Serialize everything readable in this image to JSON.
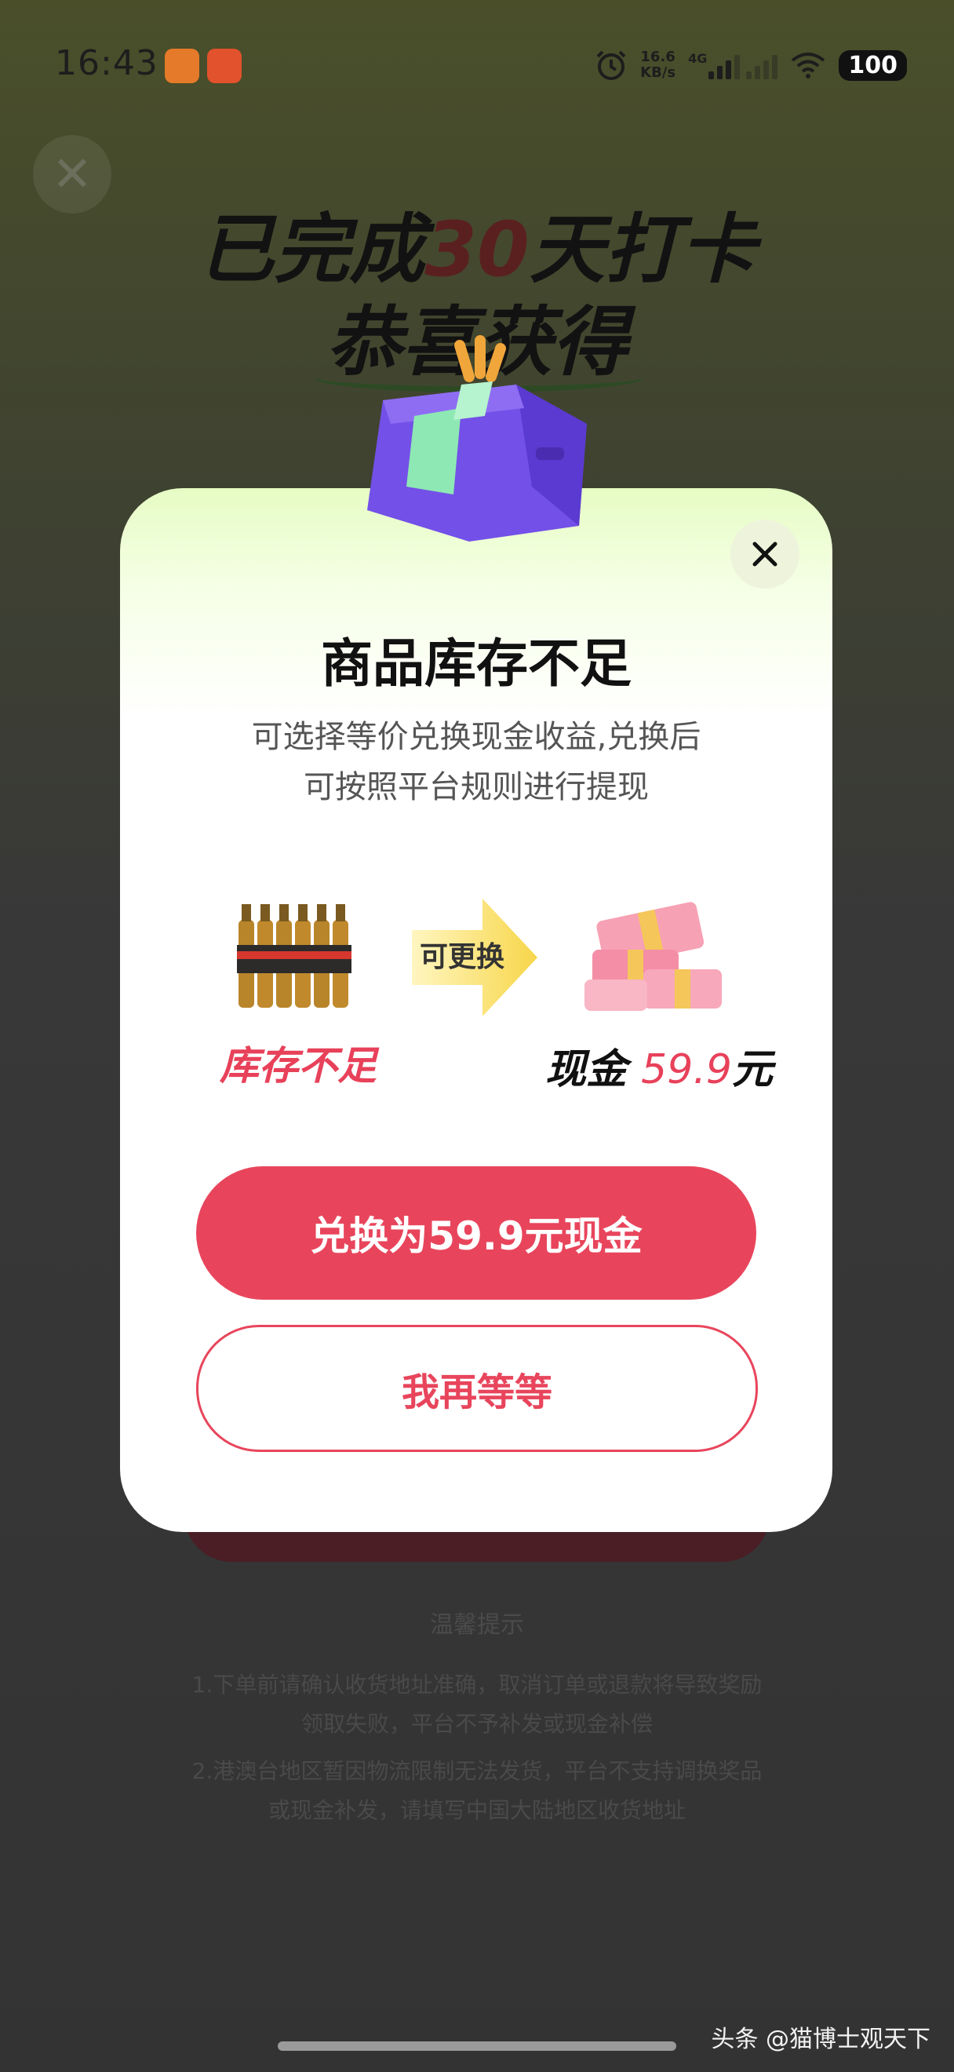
{
  "status_bar": {
    "time": "16:43",
    "net_speed_value": "16.6",
    "net_speed_unit": "KB/s",
    "network": "4G",
    "battery": "100",
    "icons": [
      "app-icon-orange",
      "app-icon-red",
      "alarm-icon",
      "signal-icon",
      "wifi-icon"
    ]
  },
  "background": {
    "title_prefix": "已完成",
    "title_days": "30",
    "title_suffix": "天打卡",
    "subtitle": "恭喜获得",
    "tips_title": "温馨提示",
    "tips": [
      "1.下单前请确认收货地址准确，取消订单或退款将导致奖励",
      "领取失败，平台不予补发或现金补偿",
      "2.港澳台地区暂因物流限制无法发货，平台不支持调换奖品",
      "或现金补发，请填写中国大陆地区收货地址"
    ]
  },
  "modal": {
    "title": "商品库存不足",
    "desc_line1": "可选择等价兑换现金收益,兑换后",
    "desc_line2": "可按照平台规则进行提现",
    "arrow_label": "可更换",
    "stock_label": "库存不足",
    "cash_label_prefix": "现金",
    "cash_amount": "59.9",
    "cash_unit": "元",
    "primary_button": "兑换为59.9元现金",
    "secondary_button": "我再等等",
    "accent_color": "#e8455c"
  },
  "watermark": "头条 @猫博士观天下"
}
